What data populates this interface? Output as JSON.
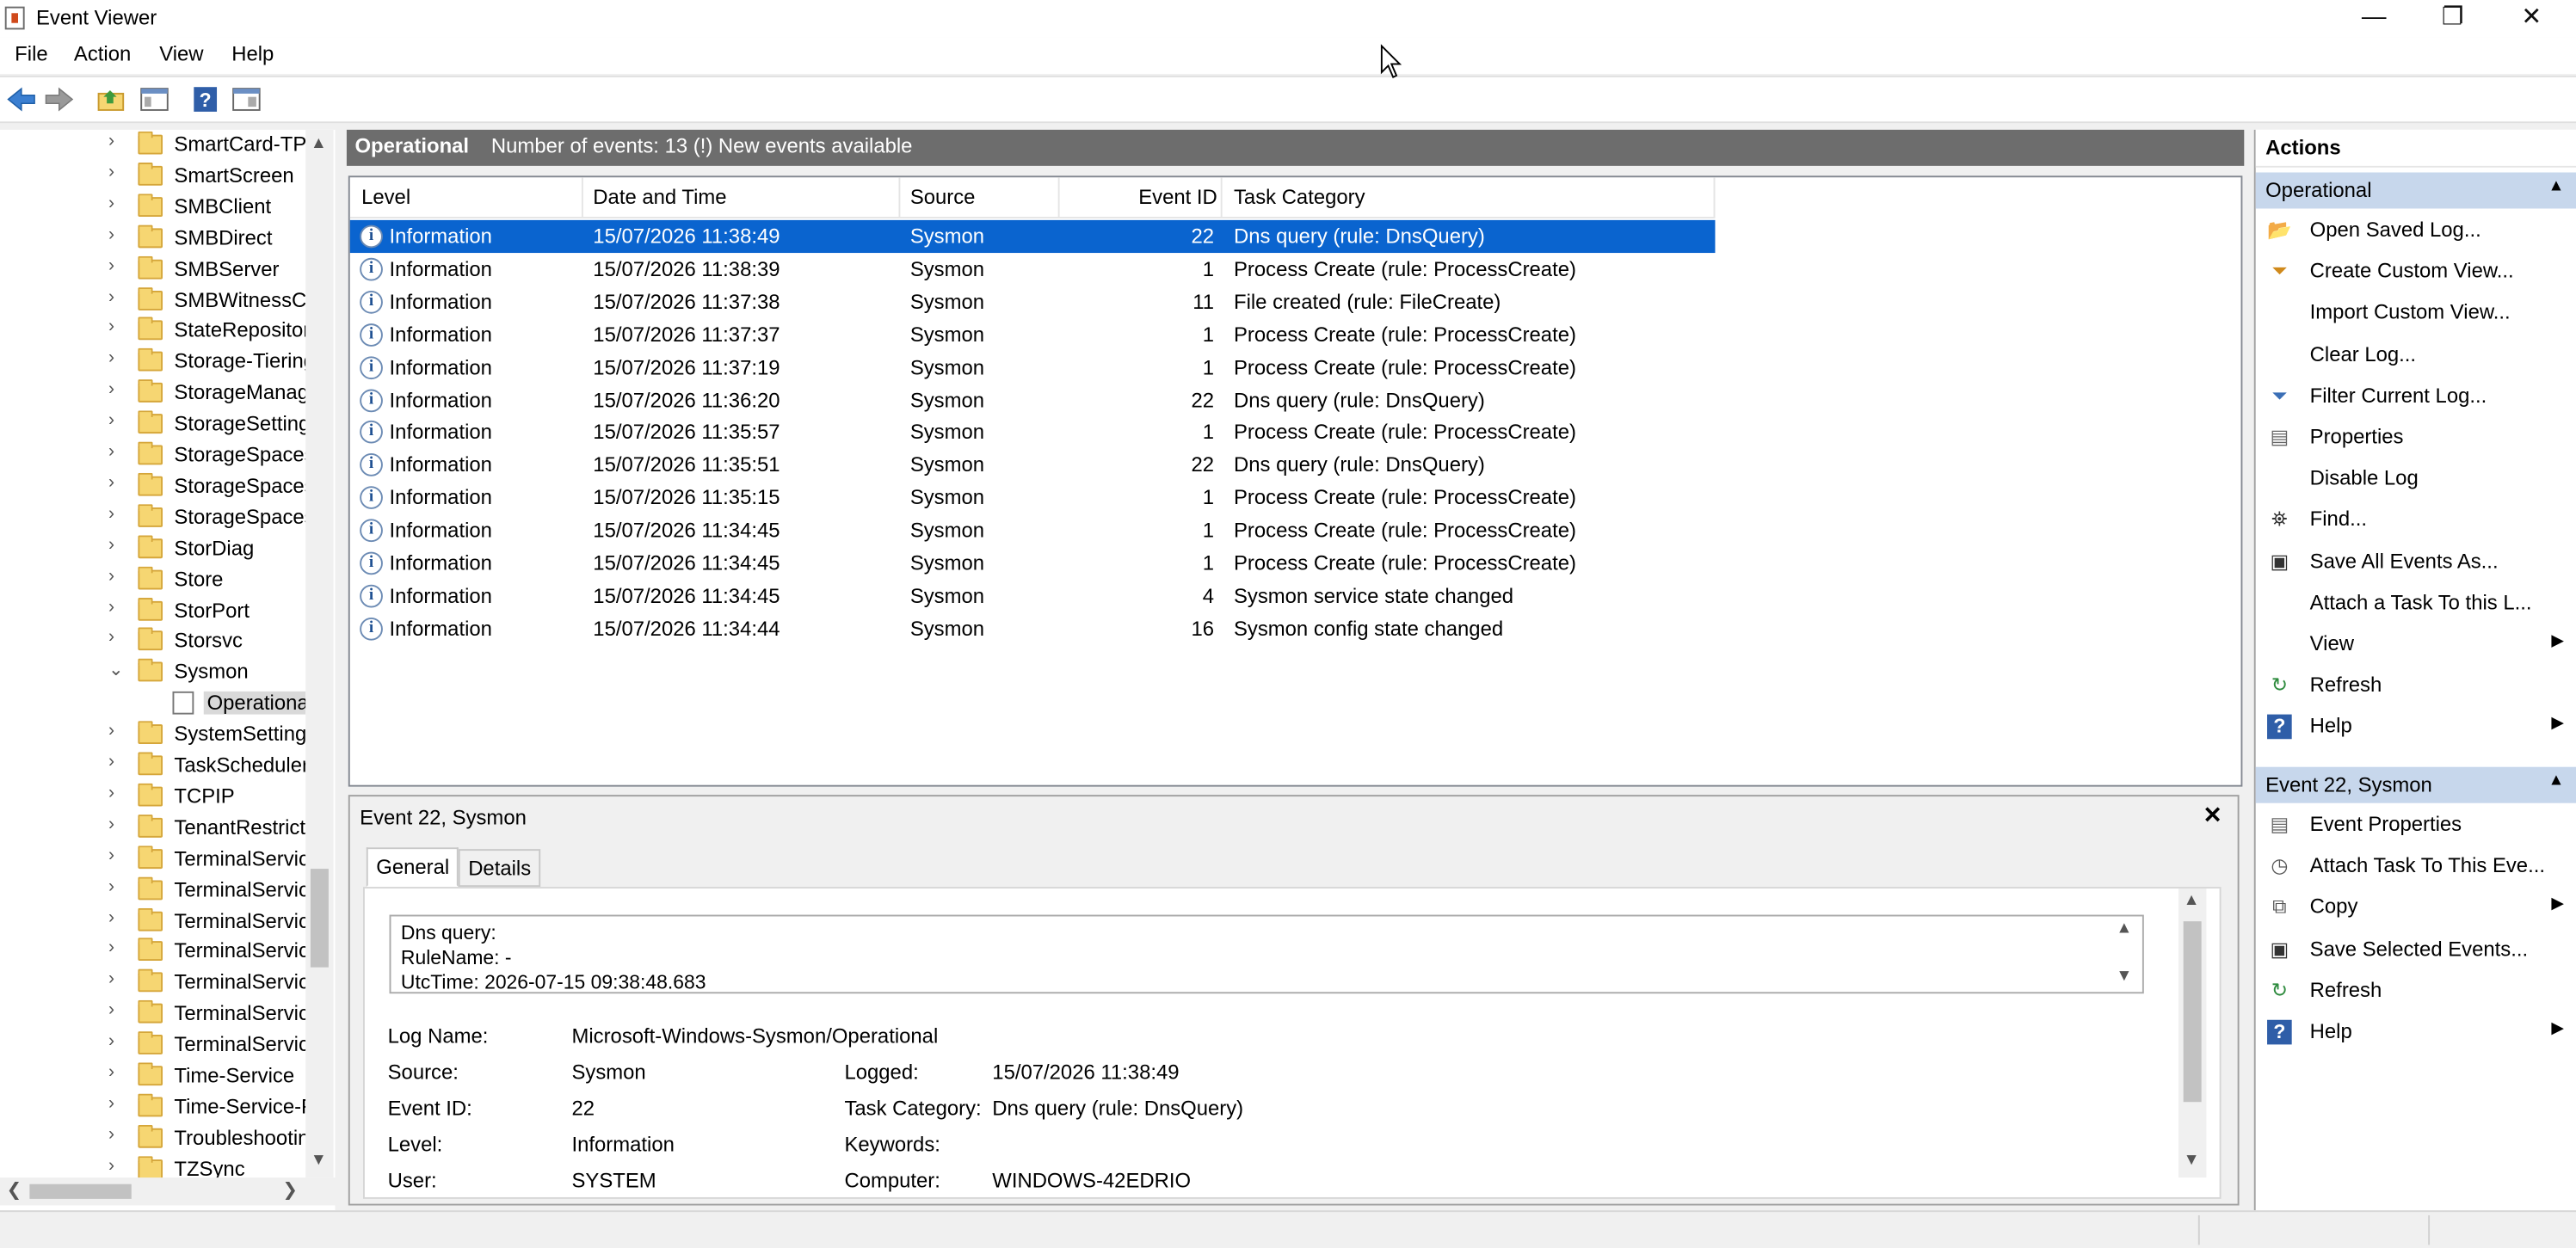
{
  "window": {
    "title": "Event Viewer",
    "controls": {
      "minimize": "—",
      "maximize": "❐",
      "close": "✕"
    }
  },
  "menu": [
    "File",
    "Action",
    "View",
    "Help"
  ],
  "tree": {
    "items": [
      "SmartCard-TPI",
      "SmartScreen",
      "SMBClient",
      "SMBDirect",
      "SMBServer",
      "SMBWitnessCl",
      "StateRepositor",
      "Storage-Tiering",
      "StorageManag",
      "StorageSetting",
      "StorageSpaces",
      "StorageSpaces",
      "StorageSpaces",
      "StorDiag",
      "Store",
      "StorPort",
      "Storsvc",
      "Sysmon",
      "Operational",
      "SystemSetting",
      "TaskScheduler",
      "TCPIP",
      "TenantRestricti",
      "TerminalServic",
      "TerminalServic",
      "TerminalServic",
      "TerminalServic",
      "TerminalServic",
      "TerminalServic",
      "TerminalServic",
      "Time-Service",
      "Time-Service-F",
      "Troubleshootin",
      "TZSync"
    ]
  },
  "list_header": {
    "title": "Operational",
    "count": "Number of events: 13 (!) New events available"
  },
  "columns": [
    "Level",
    "Date and Time",
    "Source",
    "Event ID",
    "Task Category"
  ],
  "events": [
    {
      "level": "Information",
      "datetime": "15/07/2026 11:38:49",
      "source": "Sysmon",
      "id": "22",
      "category": "Dns query (rule: DnsQuery)"
    },
    {
      "level": "Information",
      "datetime": "15/07/2026 11:38:39",
      "source": "Sysmon",
      "id": "1",
      "category": "Process Create (rule: ProcessCreate)"
    },
    {
      "level": "Information",
      "datetime": "15/07/2026 11:37:38",
      "source": "Sysmon",
      "id": "11",
      "category": "File created (rule: FileCreate)"
    },
    {
      "level": "Information",
      "datetime": "15/07/2026 11:37:37",
      "source": "Sysmon",
      "id": "1",
      "category": "Process Create (rule: ProcessCreate)"
    },
    {
      "level": "Information",
      "datetime": "15/07/2026 11:37:19",
      "source": "Sysmon",
      "id": "1",
      "category": "Process Create (rule: ProcessCreate)"
    },
    {
      "level": "Information",
      "datetime": "15/07/2026 11:36:20",
      "source": "Sysmon",
      "id": "22",
      "category": "Dns query (rule: DnsQuery)"
    },
    {
      "level": "Information",
      "datetime": "15/07/2026 11:35:57",
      "source": "Sysmon",
      "id": "1",
      "category": "Process Create (rule: ProcessCreate)"
    },
    {
      "level": "Information",
      "datetime": "15/07/2026 11:35:51",
      "source": "Sysmon",
      "id": "22",
      "category": "Dns query (rule: DnsQuery)"
    },
    {
      "level": "Information",
      "datetime": "15/07/2026 11:35:15",
      "source": "Sysmon",
      "id": "1",
      "category": "Process Create (rule: ProcessCreate)"
    },
    {
      "level": "Information",
      "datetime": "15/07/2026 11:34:45",
      "source": "Sysmon",
      "id": "1",
      "category": "Process Create (rule: ProcessCreate)"
    },
    {
      "level": "Information",
      "datetime": "15/07/2026 11:34:45",
      "source": "Sysmon",
      "id": "1",
      "category": "Process Create (rule: ProcessCreate)"
    },
    {
      "level": "Information",
      "datetime": "15/07/2026 11:34:45",
      "source": "Sysmon",
      "id": "4",
      "category": "Sysmon service state changed"
    },
    {
      "level": "Information",
      "datetime": "15/07/2026 11:34:44",
      "source": "Sysmon",
      "id": "16",
      "category": "Sysmon config state changed"
    }
  ],
  "detail": {
    "title": "Event 22, Sysmon",
    "tabs": [
      "General",
      "Details"
    ],
    "description": [
      "Dns query:",
      "RuleName: -",
      "UtcTime: 2026-07-15 09:38:48.683"
    ],
    "fields": {
      "log_name_label": "Log Name:",
      "log_name": "Microsoft-Windows-Sysmon/Operational",
      "source_label": "Source:",
      "source": "Sysmon",
      "logged_label": "Logged:",
      "logged": "15/07/2026 11:38:49",
      "event_id_label": "Event ID:",
      "event_id": "22",
      "task_category_label": "Task Category:",
      "task_category": "Dns query (rule: DnsQuery)",
      "level_label": "Level:",
      "level": "Information",
      "keywords_label": "Keywords:",
      "user_label": "User:",
      "user": "SYSTEM",
      "computer_label": "Computer:",
      "computer": "WINDOWS-42EDRIO"
    }
  },
  "actions": {
    "title": "Actions",
    "group1": {
      "title": "Operational",
      "items": [
        {
          "label": "Open Saved Log...",
          "icon": "folder-icon"
        },
        {
          "label": "Create Custom View...",
          "icon": "funnel-icon"
        },
        {
          "label": "Import Custom View...",
          "icon": ""
        },
        {
          "label": "Clear Log...",
          "icon": ""
        },
        {
          "label": "Filter Current Log...",
          "icon": "filter-icon"
        },
        {
          "label": "Properties",
          "icon": "properties-icon"
        },
        {
          "label": "Disable Log",
          "icon": ""
        },
        {
          "label": "Find...",
          "icon": "binoculars-icon"
        },
        {
          "label": "Save All Events As...",
          "icon": "save-icon"
        },
        {
          "label": "Attach a Task To this L...",
          "icon": ""
        },
        {
          "label": "View",
          "icon": "",
          "submenu": true
        },
        {
          "label": "Refresh",
          "icon": "refresh-icon"
        },
        {
          "label": "Help",
          "icon": "help-icon",
          "submenu": true
        }
      ]
    },
    "group2": {
      "title": "Event 22, Sysmon",
      "items": [
        {
          "label": "Event Properties",
          "icon": "properties-icon"
        },
        {
          "label": "Attach Task To This Eve...",
          "icon": "task-icon"
        },
        {
          "label": "Copy",
          "icon": "copy-icon",
          "submenu": true
        },
        {
          "label": "Save Selected Events...",
          "icon": "save-icon"
        },
        {
          "label": "Refresh",
          "icon": "refresh-icon"
        },
        {
          "label": "Help",
          "icon": "help-icon",
          "submenu": true
        }
      ]
    }
  },
  "colors": {
    "selection": "#0a64cf",
    "header_bar": "#6d6d6d",
    "action_group": "#c7d7ec"
  }
}
